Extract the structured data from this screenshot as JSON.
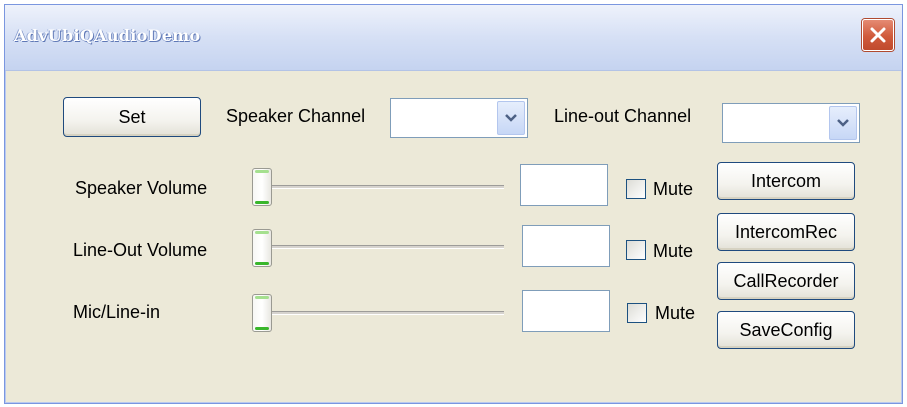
{
  "window": {
    "title": "AdvUbiQAudioDemo",
    "close_icon": "close-x-icon"
  },
  "top_row": {
    "set_label": "Set",
    "speaker_channel_label": "Speaker Channel",
    "speaker_channel_value": "",
    "line_out_channel_label": "Line-out Channel",
    "line_out_channel_value": ""
  },
  "rows": [
    {
      "label": "Speaker Volume",
      "value": "",
      "mute_label": "Mute",
      "mute_checked": false,
      "level": 0
    },
    {
      "label": "Line-Out Volume",
      "value": "",
      "mute_label": "Mute",
      "mute_checked": false,
      "level": 0
    },
    {
      "label": "Mic/Line-in",
      "value": "",
      "mute_label": "Mute",
      "mute_checked": false,
      "level": 0
    }
  ],
  "side_buttons": {
    "intercom": "Intercom",
    "intercom_rec": "IntercomRec",
    "call_recorder": "CallRecorder",
    "save_config": "SaveConfig"
  },
  "colors": {
    "titlebar": "#d6e0f5",
    "close_button": "#d05a3b",
    "window_bg": "#ece9d8",
    "slider_thumb_accent": "#39b62b"
  }
}
